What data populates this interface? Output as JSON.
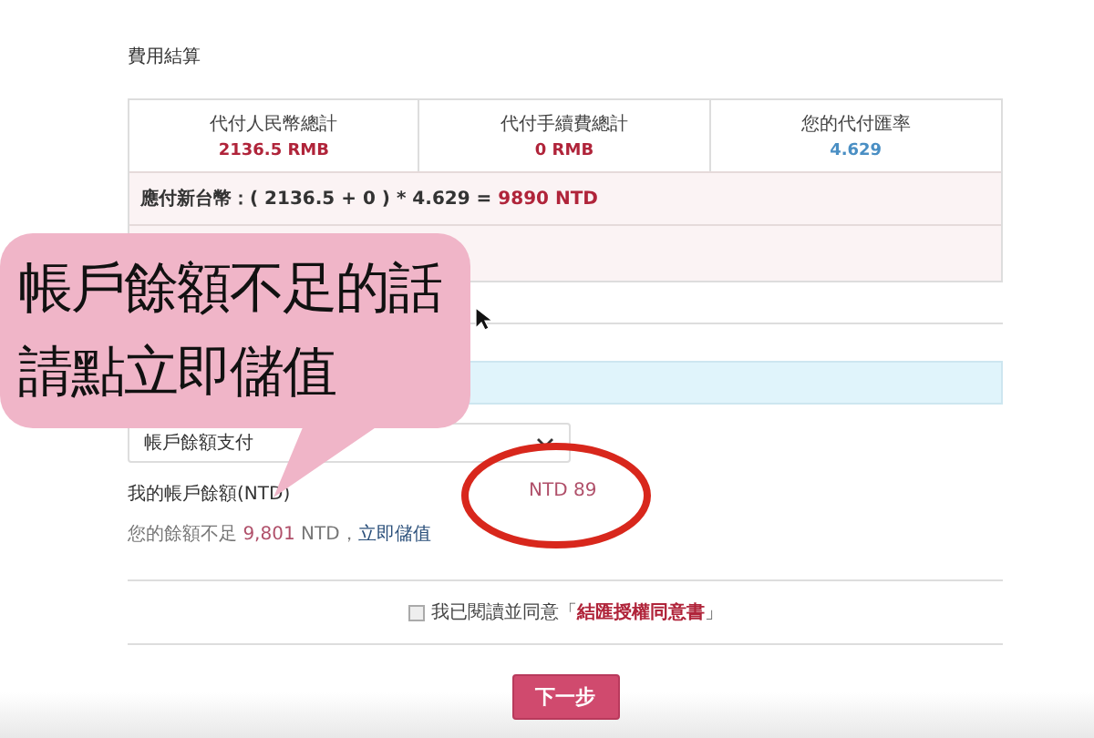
{
  "section_title": "費用結算",
  "summary": [
    {
      "label": "代付人民幣總計",
      "value": "2136.5 RMB",
      "color": "#b0243a"
    },
    {
      "label": "代付手續費總計",
      "value": "0 RMB",
      "color": "#b0243a"
    },
    {
      "label": "您的代付匯率",
      "value": "4.629",
      "color": "#4a8fc4"
    }
  ],
  "formula": {
    "text": "應付新台幣：( 2136.5 + 0 ) * 4.629 = ",
    "total": "9890 NTD"
  },
  "payment_select": {
    "value": "帳戶餘額支付"
  },
  "balance": {
    "label": "我的帳戶餘額(NTD)",
    "value": "NTD 89"
  },
  "shortfall": {
    "text": "您的餘額不足",
    "amount": "9,801",
    "unit": "NTD，",
    "link": "立即儲值"
  },
  "agreement": {
    "checked": false,
    "text": "我已閱讀並同意「",
    "link": "結匯授權同意書",
    "close": "」"
  },
  "next_button": "下一步",
  "callout": {
    "lines": [
      "帳戶餘額不足的話",
      "請點立即儲值"
    ]
  }
}
